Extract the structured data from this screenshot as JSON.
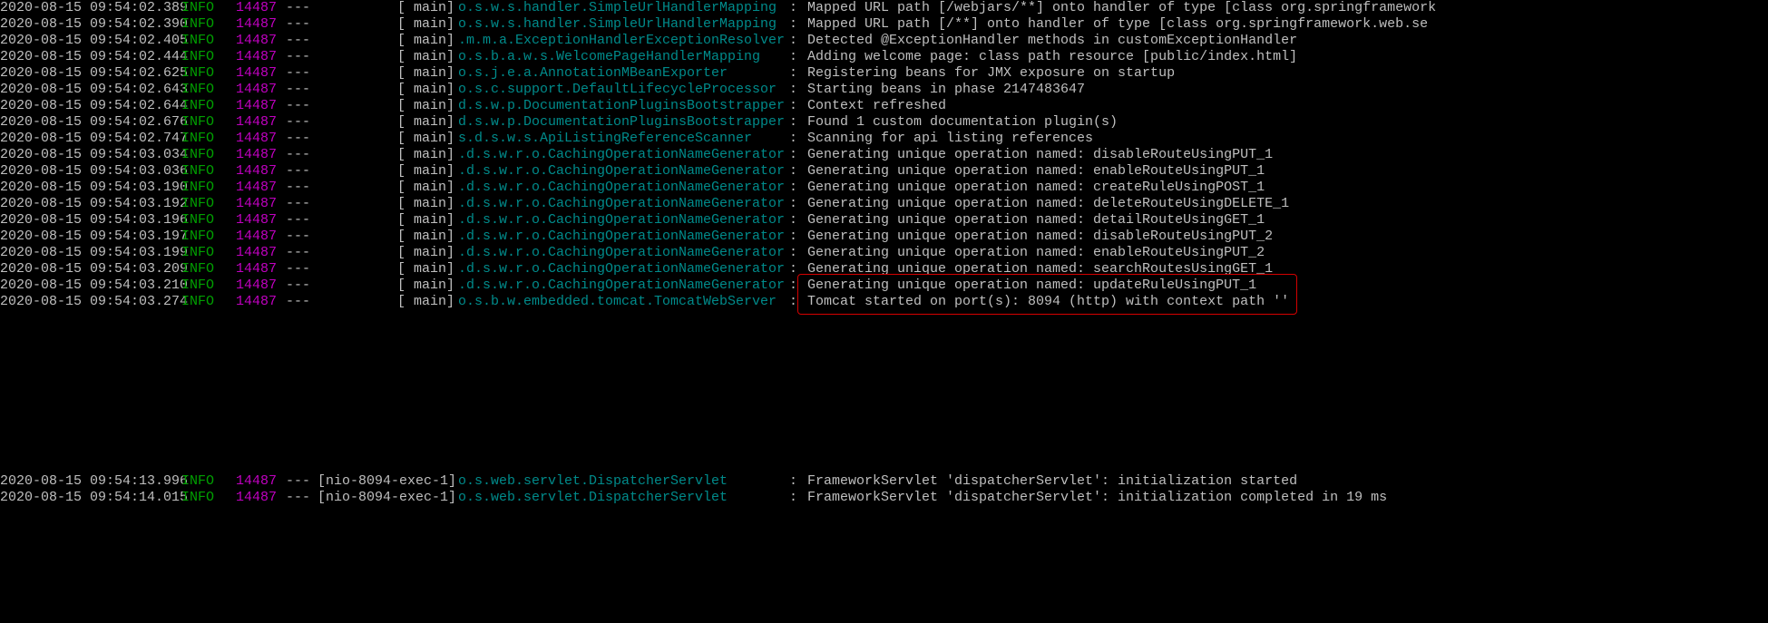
{
  "log_lines": [
    {
      "ts": "2020-08-15 09:54:02.389",
      "level": "INFO",
      "pid": "14487",
      "sep": "---",
      "thread": "[            main]",
      "class": "o.s.w.s.handler.SimpleUrlHandlerMapping",
      "colon": ":",
      "msg": "Mapped URL path [/webjars/**] onto handler of type [class org.springframework"
    },
    {
      "ts": "2020-08-15 09:54:02.390",
      "level": "INFO",
      "pid": "14487",
      "sep": "---",
      "thread": "[            main]",
      "class": "o.s.w.s.handler.SimpleUrlHandlerMapping",
      "colon": ":",
      "msg": "Mapped URL path [/**] onto handler of type [class org.springframework.web.se"
    },
    {
      "ts": "2020-08-15 09:54:02.405",
      "level": "INFO",
      "pid": "14487",
      "sep": "---",
      "thread": "[            main]",
      "class": ".m.m.a.ExceptionHandlerExceptionResolver",
      "colon": ":",
      "msg": "Detected @ExceptionHandler methods in customExceptionHandler"
    },
    {
      "ts": "2020-08-15 09:54:02.444",
      "level": "INFO",
      "pid": "14487",
      "sep": "---",
      "thread": "[            main]",
      "class": "o.s.b.a.w.s.WelcomePageHandlerMapping",
      "colon": ":",
      "msg": "Adding welcome page: class path resource [public/index.html]"
    },
    {
      "ts": "2020-08-15 09:54:02.625",
      "level": "INFO",
      "pid": "14487",
      "sep": "---",
      "thread": "[            main]",
      "class": "o.s.j.e.a.AnnotationMBeanExporter",
      "colon": ":",
      "msg": "Registering beans for JMX exposure on startup"
    },
    {
      "ts": "2020-08-15 09:54:02.643",
      "level": "INFO",
      "pid": "14487",
      "sep": "---",
      "thread": "[            main]",
      "class": "o.s.c.support.DefaultLifecycleProcessor",
      "colon": ":",
      "msg": "Starting beans in phase 2147483647"
    },
    {
      "ts": "2020-08-15 09:54:02.644",
      "level": "INFO",
      "pid": "14487",
      "sep": "---",
      "thread": "[            main]",
      "class": "d.s.w.p.DocumentationPluginsBootstrapper",
      "colon": ":",
      "msg": "Context refreshed"
    },
    {
      "ts": "2020-08-15 09:54:02.676",
      "level": "INFO",
      "pid": "14487",
      "sep": "---",
      "thread": "[            main]",
      "class": "d.s.w.p.DocumentationPluginsBootstrapper",
      "colon": ":",
      "msg": "Found 1 custom documentation plugin(s)"
    },
    {
      "ts": "2020-08-15 09:54:02.747",
      "level": "INFO",
      "pid": "14487",
      "sep": "---",
      "thread": "[            main]",
      "class": "s.d.s.w.s.ApiListingReferenceScanner",
      "colon": ":",
      "msg": "Scanning for api listing references"
    },
    {
      "ts": "2020-08-15 09:54:03.034",
      "level": "INFO",
      "pid": "14487",
      "sep": "---",
      "thread": "[            main]",
      "class": ".d.s.w.r.o.CachingOperationNameGenerator",
      "colon": ":",
      "msg": "Generating unique operation named: disableRouteUsingPUT_1"
    },
    {
      "ts": "2020-08-15 09:54:03.036",
      "level": "INFO",
      "pid": "14487",
      "sep": "---",
      "thread": "[            main]",
      "class": ".d.s.w.r.o.CachingOperationNameGenerator",
      "colon": ":",
      "msg": "Generating unique operation named: enableRouteUsingPUT_1"
    },
    {
      "ts": "2020-08-15 09:54:03.190",
      "level": "INFO",
      "pid": "14487",
      "sep": "---",
      "thread": "[            main]",
      "class": ".d.s.w.r.o.CachingOperationNameGenerator",
      "colon": ":",
      "msg": "Generating unique operation named: createRuleUsingPOST_1"
    },
    {
      "ts": "2020-08-15 09:54:03.192",
      "level": "INFO",
      "pid": "14487",
      "sep": "---",
      "thread": "[            main]",
      "class": ".d.s.w.r.o.CachingOperationNameGenerator",
      "colon": ":",
      "msg": "Generating unique operation named: deleteRouteUsingDELETE_1"
    },
    {
      "ts": "2020-08-15 09:54:03.196",
      "level": "INFO",
      "pid": "14487",
      "sep": "---",
      "thread": "[            main]",
      "class": ".d.s.w.r.o.CachingOperationNameGenerator",
      "colon": ":",
      "msg": "Generating unique operation named: detailRouteUsingGET_1"
    },
    {
      "ts": "2020-08-15 09:54:03.197",
      "level": "INFO",
      "pid": "14487",
      "sep": "---",
      "thread": "[            main]",
      "class": ".d.s.w.r.o.CachingOperationNameGenerator",
      "colon": ":",
      "msg": "Generating unique operation named: disableRouteUsingPUT_2"
    },
    {
      "ts": "2020-08-15 09:54:03.199",
      "level": "INFO",
      "pid": "14487",
      "sep": "---",
      "thread": "[            main]",
      "class": ".d.s.w.r.o.CachingOperationNameGenerator",
      "colon": ":",
      "msg": "Generating unique operation named: enableRouteUsingPUT_2"
    },
    {
      "ts": "2020-08-15 09:54:03.209",
      "level": "INFO",
      "pid": "14487",
      "sep": "---",
      "thread": "[            main]",
      "class": ".d.s.w.r.o.CachingOperationNameGenerator",
      "colon": ":",
      "msg": "Generating unique operation named: searchRoutesUsingGET_1"
    },
    {
      "ts": "2020-08-15 09:54:03.210",
      "level": "INFO",
      "pid": "14487",
      "sep": "---",
      "thread": "[            main]",
      "class": ".d.s.w.r.o.CachingOperationNameGenerator",
      "colon": ":",
      "msg": "Generating unique operation named: updateRuleUsingPUT_1"
    },
    {
      "ts": "2020-08-15 09:54:03.274",
      "level": "INFO",
      "pid": "14487",
      "sep": "---",
      "thread": "[            main]",
      "class": "o.s.b.w.embedded.tomcat.TomcatWebServer",
      "colon": ":",
      "msg": "Tomcat started on port(s): 8094 (http) with context path ''"
    }
  ],
  "log_lines_after": [
    {
      "ts": "2020-08-15 09:54:13.996",
      "level": "INFO",
      "pid": "14487",
      "sep": "---",
      "thread": "[nio-8094-exec-1]",
      "class": "o.s.web.servlet.DispatcherServlet",
      "colon": ":",
      "msg": "FrameworkServlet 'dispatcherServlet': initialization started"
    },
    {
      "ts": "2020-08-15 09:54:14.015",
      "level": "INFO",
      "pid": "14487",
      "sep": "---",
      "thread": "[nio-8094-exec-1]",
      "class": "o.s.web.servlet.DispatcherServlet",
      "colon": ":",
      "msg": "FrameworkServlet 'dispatcherServlet': initialization completed in 19 ms"
    }
  ]
}
